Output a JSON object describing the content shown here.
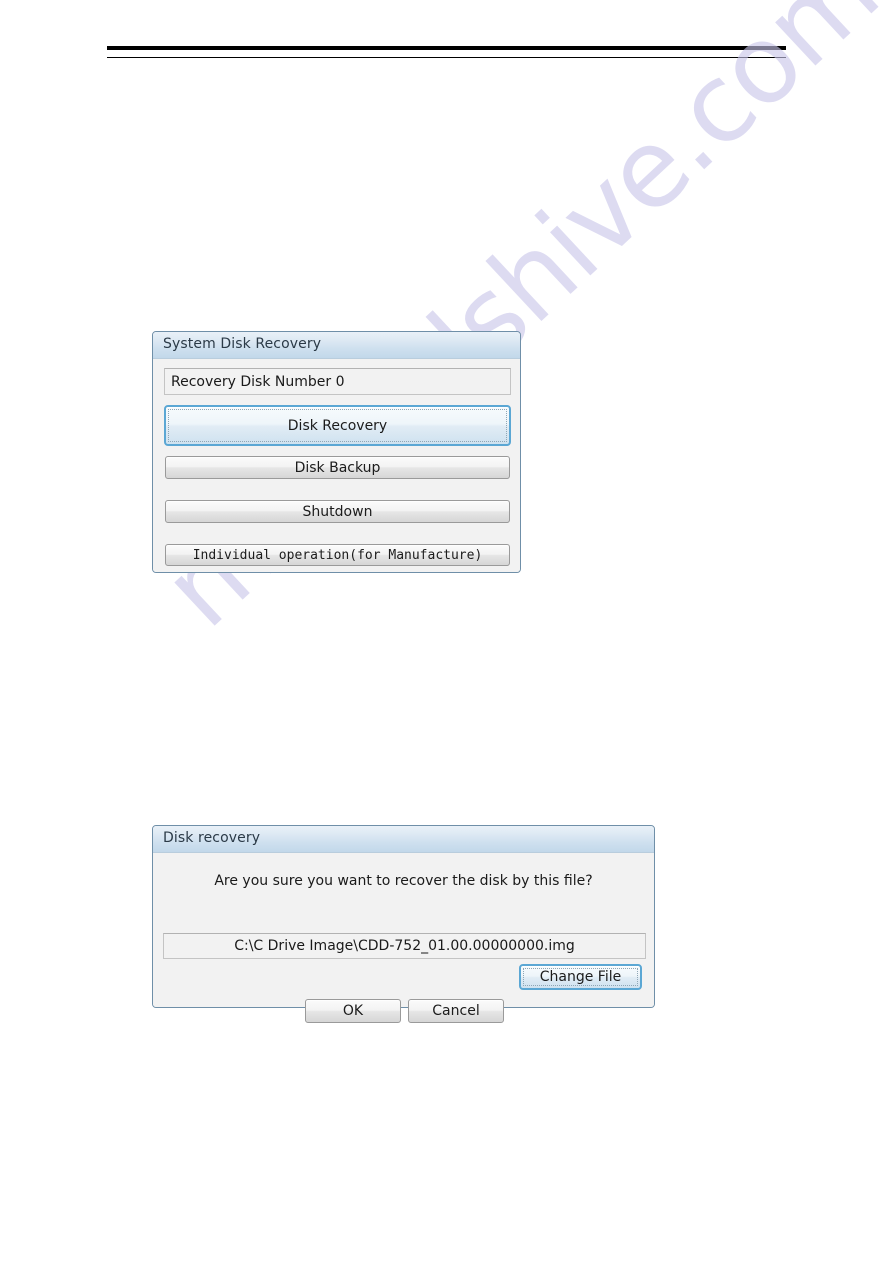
{
  "page": {
    "watermark_text": "manualshive.com",
    "header_rule_color": "#000000"
  },
  "dialogs": [
    {
      "id": "system-disk-recovery",
      "title": "System Disk Recovery",
      "field": {
        "name": "recovery-disk-number",
        "value": "Recovery Disk Number 0"
      },
      "buttons": [
        {
          "name": "disk-recovery",
          "label": "Disk Recovery",
          "focused": true,
          "mono": false
        },
        {
          "name": "disk-backup",
          "label": "Disk Backup",
          "focused": false,
          "mono": false
        },
        {
          "name": "shutdown",
          "label": "Shutdown",
          "focused": false,
          "mono": false
        },
        {
          "name": "individual-operation",
          "label": "Individual operation(for Manufacture)",
          "focused": false,
          "mono": true
        }
      ]
    },
    {
      "id": "disk-recovery-confirm",
      "title": "Disk recovery",
      "question": "Are you sure you want to recover the disk by this file?",
      "field": {
        "name": "image-path",
        "value": "C:\\C Drive Image\\CDD-752_01.00.00000000.img"
      },
      "buttons": [
        {
          "name": "change-file",
          "label": "Change File",
          "focused": true
        },
        {
          "name": "ok",
          "label": "OK",
          "focused": false
        },
        {
          "name": "cancel",
          "label": "Cancel",
          "focused": false
        }
      ]
    }
  ],
  "colors": {
    "titlebar_top": "#e9f1f8",
    "titlebar_bottom": "#c2d8ea",
    "dialog_border": "#6f8fa8",
    "focus_border": "#5ba7d4",
    "dialog_body": "#f2f2f2",
    "watermark": "#c9c6ea"
  }
}
